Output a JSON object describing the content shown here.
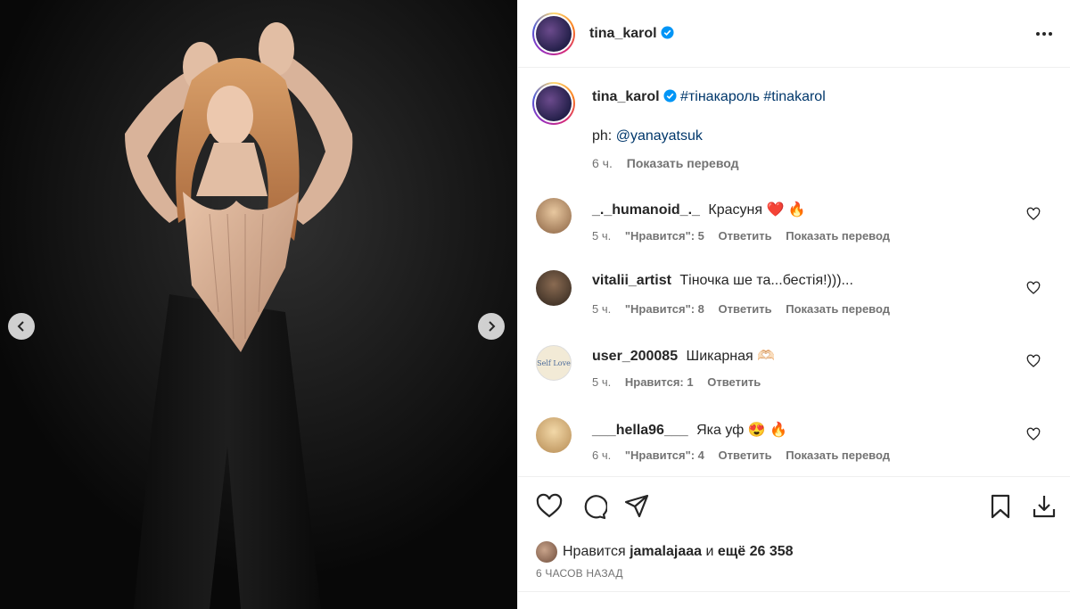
{
  "post": {
    "username": "tina_karol",
    "caption_tags": "#тінакароль #tinakarol",
    "caption_line2_prefix": "ph:",
    "caption_mention": "@yanayatsuk",
    "caption_time": "6 ч.",
    "translate_label": "Показать перевод"
  },
  "comments": [
    {
      "username": "_._humanoid_._",
      "text": "Красуня",
      "emoji": "❤️ 🔥",
      "time": "5 ч.",
      "likes": "\"Нравится\": 5",
      "reply": "Ответить",
      "translate": "Показать перевод",
      "avatar_color": "#c9a07a"
    },
    {
      "username": "vitalii_artist",
      "text": "Тіночка ше та...бестія!)))...",
      "emoji": "",
      "time": "5 ч.",
      "likes": "\"Нравится\": 8",
      "reply": "Ответить",
      "translate": "Показать перевод",
      "avatar_color": "#5a4a3e"
    },
    {
      "username": "user_200085",
      "text": "Шикарная",
      "emoji": "🫶🏻",
      "time": "5 ч.",
      "likes": "Нравится: 1",
      "reply": "Ответить",
      "translate": "",
      "avatar_color": "#f2ead6",
      "avatar_text": "Self Love"
    },
    {
      "username": "___hella96___",
      "text": "Яка уф",
      "emoji": "😍 🔥",
      "time": "6 ч.",
      "likes": "\"Нравится\": 4",
      "reply": "Ответить",
      "translate": "Показать перевод",
      "avatar_color": "#d8b88a"
    }
  ],
  "likes": {
    "prefix": "Нравится",
    "user": "jamalajaaa",
    "middle": "и",
    "count": "ещё 26 358"
  },
  "timestamp": "6 ЧАСОВ НАЗАД",
  "colors": {
    "link": "#00376b",
    "verified": "#0095f6",
    "muted": "#737373"
  },
  "icons": [
    "more-icon",
    "chevron-left-icon",
    "chevron-right-icon",
    "heart-icon",
    "comment-icon",
    "share-icon",
    "bookmark-icon",
    "download-icon",
    "verified-icon"
  ]
}
